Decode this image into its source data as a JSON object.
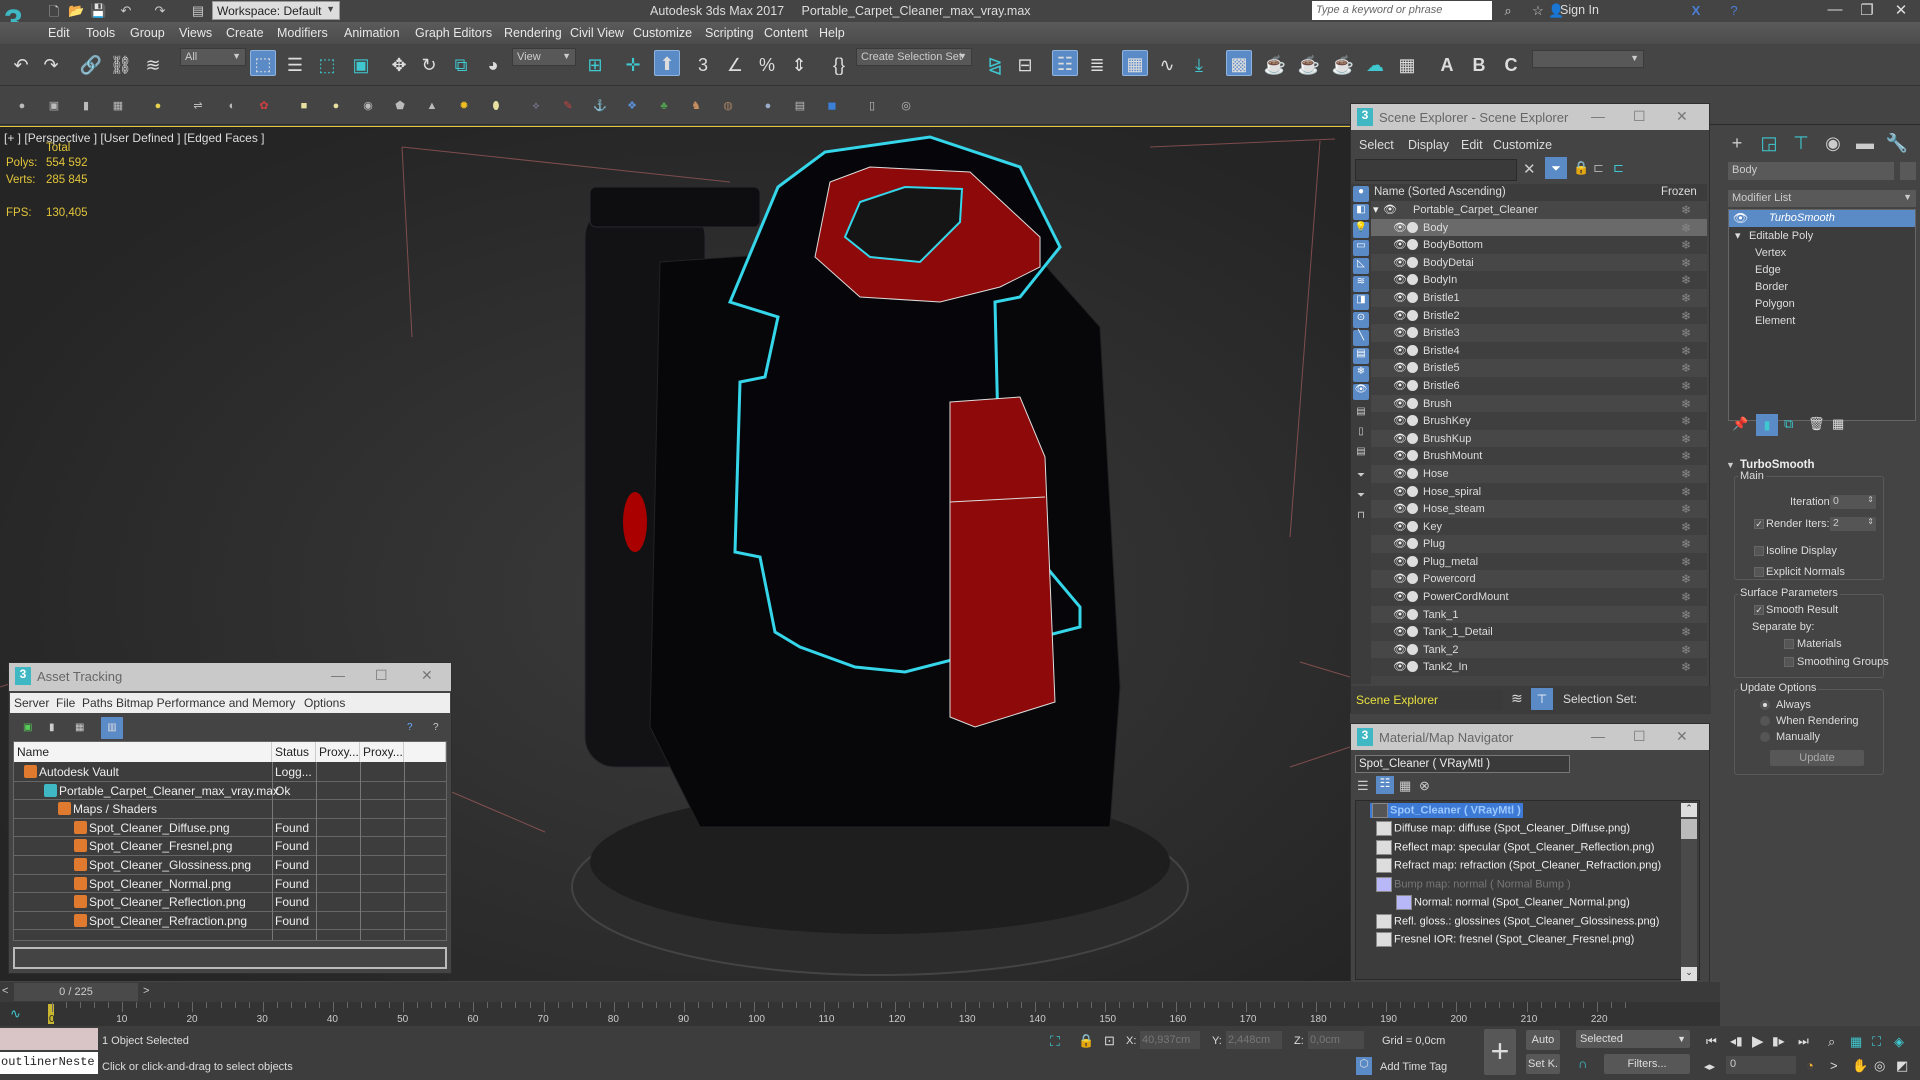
{
  "titlebar": {
    "app_title": "Autodesk 3ds Max 2017",
    "file_name": "Portable_Carpet_Cleaner_max_vray.max",
    "workspace": "Workspace: Default",
    "search_placeholder": "Type a keyword or phrase",
    "sign_in": "Sign In"
  },
  "menu": [
    "Edit",
    "Tools",
    "Group",
    "Views",
    "Create",
    "Modifiers",
    "Animation",
    "Graph Editors",
    "Rendering",
    "Civil View",
    "Customize",
    "Scripting",
    "Content",
    "Help"
  ],
  "toolbar": {
    "selection_filter": "All",
    "ref_coord": "View",
    "selection_set": "Create Selection Set",
    "snap_angle_label": "3",
    "named_render_preset": ""
  },
  "viewport": {
    "label_plus": "[+ ]",
    "label_view": "[Perspective ]",
    "label_shading": "[User Defined ]",
    "label_mode": "[Edged Faces ]",
    "stats_header": "Total",
    "polys_label": "Polys:",
    "polys_value": "554 592",
    "verts_label": "Verts:",
    "verts_value": "285 845",
    "fps_label": "FPS:",
    "fps_value": "130,405",
    "model_colors": {
      "body": "#0a0a0c",
      "accent": "#8e0a0a",
      "selection_outline": "#35d6ea",
      "base": "#2f2f2f"
    }
  },
  "scene_explorer": {
    "title": "Scene Explorer - Scene Explorer",
    "menu": [
      "Select",
      "Display",
      "Edit",
      "Customize"
    ],
    "col_name": "Name (Sorted Ascending)",
    "col_frozen": "Frozen",
    "root": "Portable_Carpet_Cleaner",
    "items": [
      "Body",
      "BodyBottom",
      "BodyDetai",
      "BodyIn",
      "Bristle1",
      "Bristle2",
      "Bristle3",
      "Bristle4",
      "Bristle5",
      "Bristle6",
      "Brush",
      "BrushKey",
      "BrushKup",
      "BrushMount",
      "Hose",
      "Hose_spiral",
      "Hose_steam",
      "Key",
      "Plug",
      "Plug_metal",
      "Powercord",
      "PowerCordMount",
      "Tank_1",
      "Tank_1_Detail",
      "Tank_2",
      "Tank2_In"
    ],
    "selected_item": "Body",
    "footer_dropdown": "Scene Explorer",
    "selection_set_label": "Selection Set:"
  },
  "material_navigator": {
    "title": "Material/Map Navigator",
    "current": "Spot_Cleaner  ( VRayMtl )",
    "root": "Spot_Cleaner  ( VRayMtl )",
    "maps": [
      "Diffuse map: diffuse (Spot_Cleaner_Diffuse.png)",
      "Reflect map: specular (Spot_Cleaner_Reflection.png)",
      "Refract map: refraction (Spot_Cleaner_Refraction.png)",
      "Bump map: normal  ( Normal Bump )",
      "Normal: normal (Spot_Cleaner_Normal.png)",
      "Refl. gloss.: glossines (Spot_Cleaner_Glossiness.png)",
      "Fresnel IOR: fresnel (Spot_Cleaner_Fresnel.png)"
    ]
  },
  "command_panel": {
    "object_name": "Body",
    "modifier_list": "Modifier List",
    "stack": {
      "top": "TurboSmooth",
      "base": "Editable Poly",
      "subobjects": [
        "Vertex",
        "Edge",
        "Border",
        "Polygon",
        "Element"
      ]
    },
    "rollout": {
      "title": "TurboSmooth",
      "main_group": "Main",
      "iterations_label": "Iterations:",
      "iterations": "0",
      "render_iters_label": "Render Iters:",
      "render_iters": "2",
      "render_iters_checked": true,
      "isoline_display": "Isoline Display",
      "explicit_normals": "Explicit Normals",
      "surface_group": "Surface Parameters",
      "smooth_result": "Smooth Result",
      "separate_by": "Separate by:",
      "materials": "Materials",
      "smoothing_groups": "Smoothing Groups",
      "update_group": "Update Options",
      "always": "Always",
      "when_rendering": "When Rendering",
      "manually": "Manually",
      "update_button": "Update"
    }
  },
  "asset_tracking": {
    "title": "Asset Tracking",
    "menu": [
      "Server",
      "File",
      "Paths",
      "Bitmap Performance and Memory",
      "Options"
    ],
    "columns": [
      "Name",
      "Status",
      "Proxy...",
      "Proxy..."
    ],
    "rows": [
      {
        "name": "Autodesk Vault",
        "status": "Logg..."
      },
      {
        "name": "Portable_Carpet_Cleaner_max_vray.max",
        "status": "Ok"
      },
      {
        "name": "Maps / Shaders",
        "status": ""
      },
      {
        "name": "Spot_Cleaner_Diffuse.png",
        "status": "Found"
      },
      {
        "name": "Spot_Cleaner_Fresnel.png",
        "status": "Found"
      },
      {
        "name": "Spot_Cleaner_Glossiness.png",
        "status": "Found"
      },
      {
        "name": "Spot_Cleaner_Normal.png",
        "status": "Found"
      },
      {
        "name": "Spot_Cleaner_Reflection.png",
        "status": "Found"
      },
      {
        "name": "Spot_Cleaner_Refraction.png",
        "status": "Found"
      }
    ]
  },
  "timeline": {
    "frame_display": "0 / 225",
    "ticks": [
      "0",
      "10",
      "20",
      "30",
      "40",
      "50",
      "60",
      "70",
      "80",
      "90",
      "100",
      "110",
      "120",
      "130",
      "140",
      "150",
      "160",
      "170",
      "180",
      "190",
      "200",
      "210",
      "220"
    ]
  },
  "status": {
    "listener": "outlinerNeste",
    "selected_text": "1 Object Selected",
    "prompt": "Click or click-and-drag to select objects",
    "x_label": "X:",
    "x": "40,937cm",
    "y_label": "Y:",
    "y": "2,448cm",
    "z_label": "Z:",
    "z": "0,0cm",
    "grid": "Grid = 0,0cm",
    "add_time_tag": "Add Time Tag",
    "auto": "Auto",
    "set_key": "Set K.",
    "key_filter": "Selected",
    "filters": "Filters...",
    "current_frame": "0"
  }
}
